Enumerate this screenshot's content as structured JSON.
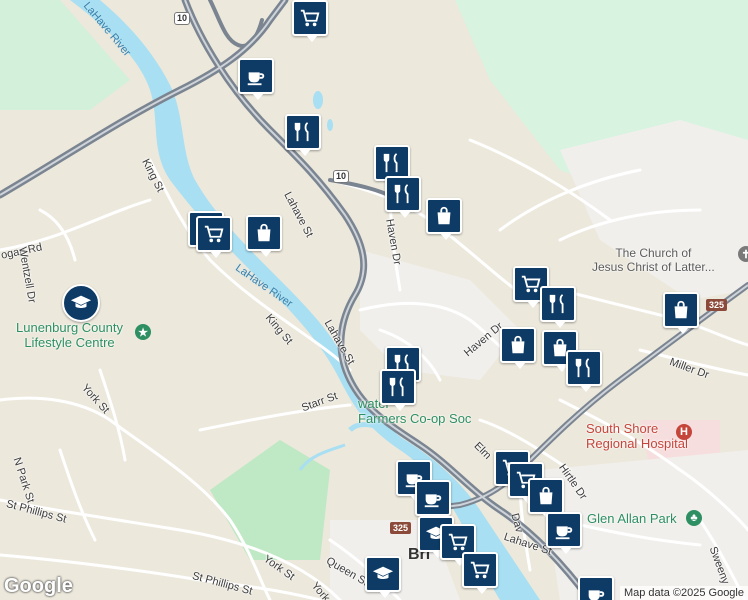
{
  "map": {
    "roads": {
      "route_10": "10",
      "route_325": "325"
    },
    "streets": {
      "lahave_st_upper": "Lahave St",
      "lahave_st_mid": "Lahave St",
      "lahave_st_lower": "Lahave St",
      "king_st_upper": "King St",
      "king_st_lower": "King St",
      "haven_dr_upper": "Haven Dr",
      "haven_dr_lower": "Haven Dr",
      "logan_rd": "ogan Rd",
      "wentzell_dr": "Wentzell Dr",
      "york_st_mid": "York St",
      "york_st_lower": "York St",
      "york_st_bottom": "York",
      "starr_st": "Starr St",
      "n_park_st": "N Park St",
      "st_phillips_st_left": "St Phillips St",
      "st_phillips_st_bottom": "St Phillips St",
      "queen_st": "Queen St",
      "miller_dr": "Miller Dr",
      "hirtle_dr": "Hirtle Dr",
      "elm": "Elm",
      "dav": "Dav",
      "sweeny": "Sweeny"
    },
    "river_labels": [
      "LaHave River",
      "LaHave River"
    ],
    "places": {
      "lunenburg": "Lunenburg County\nLifestyle Centre",
      "farmers": "water\nFarmers Co-op Soc",
      "church": "The Church of\nJesus Christ of Latter...",
      "hospital": "South Shore\nRegional Hospital",
      "park": "Glen Allan Park",
      "town": "Bri"
    },
    "markers": [
      "coffee-icon",
      "cart-icon",
      "fork-knife-icon",
      "bag-icon",
      "graduation-icon"
    ],
    "colors": {
      "marker": "#0d3b66",
      "water": "#a8dff2",
      "park": "#bfe8c4",
      "highway": "#7b8591",
      "hospital": "#f7dede"
    }
  },
  "footer": {
    "logo": "Google",
    "attribution": "Map data ©2025 Google"
  }
}
